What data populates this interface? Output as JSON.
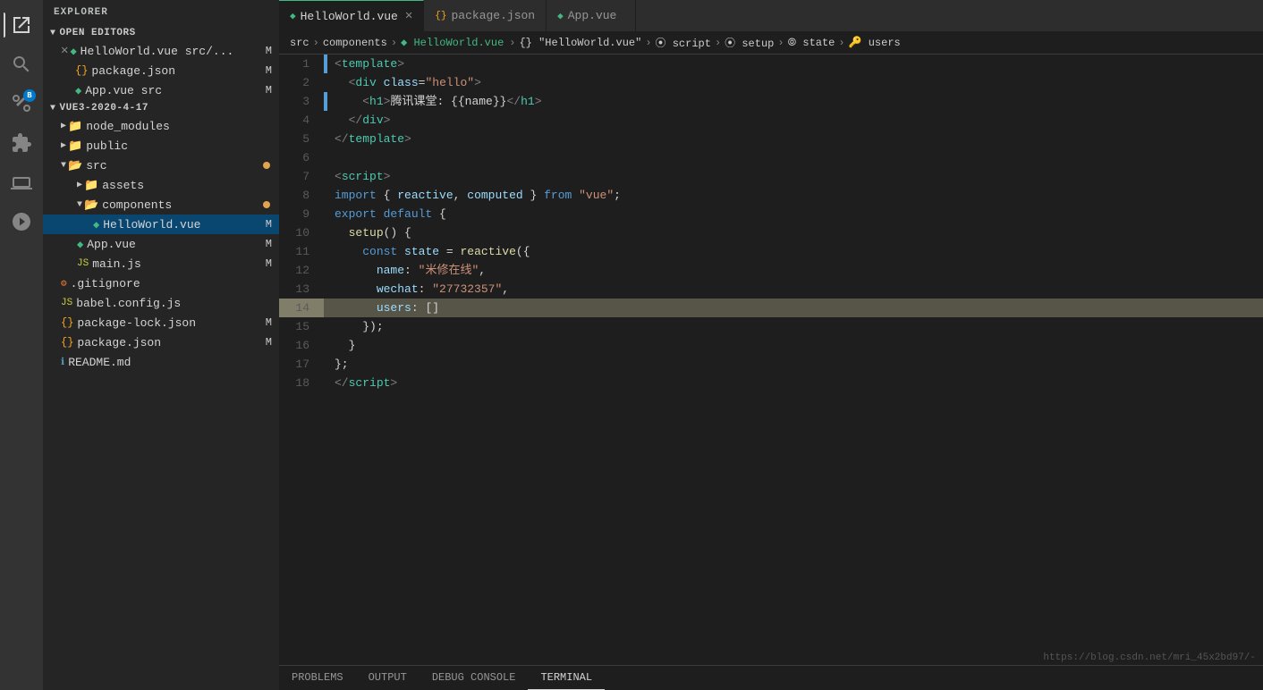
{
  "activity_bar": {
    "icons": [
      {
        "name": "explorer-icon",
        "symbol": "⊞",
        "active": true
      },
      {
        "name": "search-icon",
        "symbol": "🔍",
        "active": false
      },
      {
        "name": "source-control-icon",
        "symbol": "⑂",
        "active": false
      },
      {
        "name": "extensions-icon",
        "symbol": "⊟",
        "active": false
      },
      {
        "name": "debug-icon",
        "symbol": "▷",
        "active": false
      },
      {
        "name": "remote-icon",
        "symbol": "⊕",
        "active": false
      }
    ]
  },
  "sidebar": {
    "title": "EXPLORER",
    "open_editors_label": "OPEN EDITORS",
    "open_editors": [
      {
        "name": "HelloWorld.vue src/...",
        "type": "vue",
        "modified": "M",
        "active": true,
        "has_close": true
      },
      {
        "name": "package.json",
        "type": "json",
        "modified": "M",
        "active": false,
        "has_close": false
      },
      {
        "name": "App.vue  src",
        "type": "vue",
        "modified": "M",
        "active": false,
        "has_close": false
      }
    ],
    "project_label": "VUE3-2020-4-17",
    "tree": [
      {
        "name": "node_modules",
        "type": "folder",
        "indent": 1,
        "open": false
      },
      {
        "name": "public",
        "type": "folder",
        "indent": 1,
        "open": false
      },
      {
        "name": "src",
        "type": "folder",
        "indent": 1,
        "open": true,
        "dot": true
      },
      {
        "name": "assets",
        "type": "folder",
        "indent": 2,
        "open": false
      },
      {
        "name": "components",
        "type": "folder",
        "indent": 2,
        "open": true,
        "dot": true
      },
      {
        "name": "HelloWorld.vue",
        "type": "vue",
        "indent": 3,
        "modified": "M",
        "active": true
      },
      {
        "name": "App.vue",
        "type": "vue",
        "indent": 2,
        "modified": "M"
      },
      {
        "name": "main.js",
        "type": "js",
        "indent": 2,
        "modified": "M"
      },
      {
        "name": ".gitignore",
        "type": "git",
        "indent": 1
      },
      {
        "name": "babel.config.js",
        "type": "js",
        "indent": 1
      },
      {
        "name": "package-lock.json",
        "type": "json",
        "indent": 1,
        "modified": "M"
      },
      {
        "name": "package.json",
        "type": "json",
        "indent": 1,
        "modified": "M"
      },
      {
        "name": "README.md",
        "type": "md",
        "indent": 1
      }
    ]
  },
  "tabs": [
    {
      "label": "HelloWorld.vue",
      "type": "vue",
      "active": true,
      "closeable": true
    },
    {
      "label": "package.json",
      "type": "json",
      "active": false,
      "closeable": false
    },
    {
      "label": "App.vue",
      "type": "vue",
      "active": false,
      "closeable": false
    }
  ],
  "breadcrumb": {
    "items": [
      "src",
      "components",
      "HelloWorld.vue",
      "{} \"HelloWorld.vue\"",
      "script",
      "setup",
      "state",
      "users"
    ]
  },
  "code": {
    "lines": [
      {
        "num": 1,
        "tokens": [
          {
            "t": "tag-bracket",
            "v": "<"
          },
          {
            "t": "tag",
            "v": "template"
          },
          {
            "t": "tag-bracket",
            "v": ">"
          }
        ]
      },
      {
        "num": 2,
        "tokens": [
          {
            "t": "sp",
            "v": "  "
          },
          {
            "t": "tag-bracket",
            "v": "<"
          },
          {
            "t": "tag",
            "v": "div"
          },
          {
            "t": "sp",
            "v": " "
          },
          {
            "t": "attr",
            "v": "class"
          },
          {
            "t": "pun",
            "v": "="
          },
          {
            "t": "str",
            "v": "\"hello\""
          },
          {
            "t": "tag-bracket",
            "v": ">"
          }
        ]
      },
      {
        "num": 3,
        "tokens": [
          {
            "t": "sp",
            "v": "    "
          },
          {
            "t": "tag-bracket",
            "v": "<"
          },
          {
            "t": "tag",
            "v": "h1"
          },
          {
            "t": "tag-bracket",
            "v": ">"
          },
          {
            "t": "op",
            "v": "腾讯课堂: {{name}}"
          },
          {
            "t": "tag-bracket",
            "v": "</"
          },
          {
            "t": "tag",
            "v": "h1"
          },
          {
            "t": "tag-bracket",
            "v": ">"
          }
        ]
      },
      {
        "num": 4,
        "tokens": [
          {
            "t": "sp",
            "v": "  "
          },
          {
            "t": "tag-bracket",
            "v": "</"
          },
          {
            "t": "tag",
            "v": "div"
          },
          {
            "t": "tag-bracket",
            "v": ">"
          }
        ]
      },
      {
        "num": 5,
        "tokens": [
          {
            "t": "tag-bracket",
            "v": "</"
          },
          {
            "t": "tag",
            "v": "template"
          },
          {
            "t": "tag-bracket",
            "v": ">"
          }
        ]
      },
      {
        "num": 6,
        "tokens": []
      },
      {
        "num": 7,
        "tokens": [
          {
            "t": "tag-bracket",
            "v": "<"
          },
          {
            "t": "tag",
            "v": "script"
          },
          {
            "t": "tag-bracket",
            "v": ">"
          }
        ]
      },
      {
        "num": 8,
        "tokens": [
          {
            "t": "kw",
            "v": "import"
          },
          {
            "t": "op",
            "v": " { "
          },
          {
            "t": "var-blue",
            "v": "reactive"
          },
          {
            "t": "pun",
            "v": ","
          },
          {
            "t": "sp",
            "v": " "
          },
          {
            "t": "var-blue",
            "v": "computed"
          },
          {
            "t": "op",
            "v": " } "
          },
          {
            "t": "kw",
            "v": "from"
          },
          {
            "t": "sp",
            "v": " "
          },
          {
            "t": "str",
            "v": "\"vue\""
          },
          {
            "t": "pun",
            "v": ";"
          }
        ]
      },
      {
        "num": 9,
        "tokens": [
          {
            "t": "kw",
            "v": "export"
          },
          {
            "t": "sp",
            "v": " "
          },
          {
            "t": "kw",
            "v": "default"
          },
          {
            "t": "sp",
            "v": " "
          },
          {
            "t": "pun",
            "v": "{"
          }
        ]
      },
      {
        "num": 10,
        "tokens": [
          {
            "t": "sp",
            "v": "  "
          },
          {
            "t": "fn",
            "v": "setup"
          },
          {
            "t": "pun",
            "v": "() {"
          }
        ]
      },
      {
        "num": 11,
        "tokens": [
          {
            "t": "sp",
            "v": "    "
          },
          {
            "t": "kw",
            "v": "const"
          },
          {
            "t": "sp",
            "v": " "
          },
          {
            "t": "var-blue",
            "v": "state"
          },
          {
            "t": "sp",
            "v": " "
          },
          {
            "t": "op",
            "v": "="
          },
          {
            "t": "sp",
            "v": " "
          },
          {
            "t": "fn",
            "v": "reactive"
          },
          {
            "t": "pun",
            "v": "({"
          }
        ]
      },
      {
        "num": 12,
        "tokens": [
          {
            "t": "sp",
            "v": "      "
          },
          {
            "t": "attr",
            "v": "name"
          },
          {
            "t": "pun",
            "v": ":"
          },
          {
            "t": "sp",
            "v": " "
          },
          {
            "t": "str",
            "v": "\"米修在线\""
          },
          {
            "t": "pun",
            "v": ","
          }
        ]
      },
      {
        "num": 13,
        "tokens": [
          {
            "t": "sp",
            "v": "      "
          },
          {
            "t": "attr",
            "v": "wechat"
          },
          {
            "t": "pun",
            "v": ":"
          },
          {
            "t": "sp",
            "v": " "
          },
          {
            "t": "str",
            "v": "\"27732357\""
          },
          {
            "t": "pun",
            "v": ","
          }
        ]
      },
      {
        "num": 14,
        "tokens": [
          {
            "t": "sp",
            "v": "      "
          },
          {
            "t": "attr",
            "v": "users"
          },
          {
            "t": "pun",
            "v": ":"
          },
          {
            "t": "sp",
            "v": " "
          },
          {
            "t": "pun",
            "v": "[]"
          }
        ],
        "highlighted": true
      },
      {
        "num": 15,
        "tokens": [
          {
            "t": "sp",
            "v": "    "
          },
          {
            "t": "pun",
            "v": "});"
          }
        ]
      },
      {
        "num": 16,
        "tokens": [
          {
            "t": "sp",
            "v": "  "
          },
          {
            "t": "pun",
            "v": "}"
          }
        ]
      },
      {
        "num": 17,
        "tokens": [
          {
            "t": "pun",
            "v": "};"
          }
        ]
      },
      {
        "num": 18,
        "tokens": [
          {
            "t": "tag-bracket",
            "v": "</"
          },
          {
            "t": "tag",
            "v": "script"
          },
          {
            "t": "tag-bracket",
            "v": ">"
          }
        ]
      }
    ]
  },
  "bottom_tabs": {
    "items": [
      "PROBLEMS",
      "OUTPUT",
      "DEBUG CONSOLE",
      "TERMINAL"
    ],
    "active": "TERMINAL"
  },
  "watermark": "https://blog.csdn.net/mri_45x2bd97/-"
}
